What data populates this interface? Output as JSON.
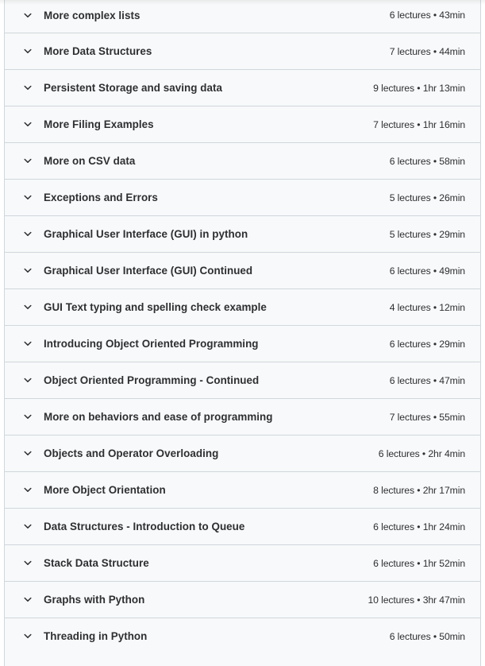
{
  "curriculum": {
    "sections": [
      {
        "title": "More complex lists",
        "meta": "6 lectures • 43min",
        "lectures": 6,
        "duration": "43min",
        "icon": "chevron-down-icon"
      },
      {
        "title": "More Data Structures",
        "meta": "7 lectures • 44min",
        "lectures": 7,
        "duration": "44min",
        "icon": "chevron-down-icon"
      },
      {
        "title": "Persistent Storage and saving data",
        "meta": "9 lectures • 1hr 13min",
        "lectures": 9,
        "duration": "1hr 13min",
        "icon": "chevron-down-icon"
      },
      {
        "title": "More Filing Examples",
        "meta": "7 lectures • 1hr 16min",
        "lectures": 7,
        "duration": "1hr 16min",
        "icon": "chevron-down-icon"
      },
      {
        "title": "More on CSV data",
        "meta": "6 lectures • 58min",
        "lectures": 6,
        "duration": "58min",
        "icon": "chevron-down-icon"
      },
      {
        "title": "Exceptions and Errors",
        "meta": "5 lectures • 26min",
        "lectures": 5,
        "duration": "26min",
        "icon": "chevron-down-icon"
      },
      {
        "title": "Graphical User Interface (GUI) in python",
        "meta": "5 lectures • 29min",
        "lectures": 5,
        "duration": "29min",
        "icon": "chevron-down-icon"
      },
      {
        "title": "Graphical User Interface (GUI) Continued",
        "meta": "6 lectures • 49min",
        "lectures": 6,
        "duration": "49min",
        "icon": "chevron-down-icon"
      },
      {
        "title": "GUI Text typing and spelling check example",
        "meta": "4 lectures • 12min",
        "lectures": 4,
        "duration": "12min",
        "icon": "chevron-down-icon"
      },
      {
        "title": "Introducing Object Oriented Programming",
        "meta": "6 lectures • 29min",
        "lectures": 6,
        "duration": "29min",
        "icon": "chevron-down-icon"
      },
      {
        "title": "Object Oriented Programming - Continued",
        "meta": "6 lectures • 47min",
        "lectures": 6,
        "duration": "47min",
        "icon": "chevron-down-icon"
      },
      {
        "title": "More on behaviors and ease of programming",
        "meta": "7 lectures • 55min",
        "lectures": 7,
        "duration": "55min",
        "icon": "chevron-down-icon"
      },
      {
        "title": "Objects and Operator Overloading",
        "meta": "6 lectures • 2hr 4min",
        "lectures": 6,
        "duration": "2hr 4min",
        "icon": "chevron-down-icon"
      },
      {
        "title": "More Object Orientation",
        "meta": "8 lectures • 2hr 17min",
        "lectures": 8,
        "duration": "2hr 17min",
        "icon": "chevron-down-icon"
      },
      {
        "title": "Data Structures - Introduction to Queue",
        "meta": "6 lectures • 1hr 24min",
        "lectures": 6,
        "duration": "1hr 24min",
        "icon": "chevron-down-icon"
      },
      {
        "title": "Stack Data Structure",
        "meta": "6 lectures • 1hr 52min",
        "lectures": 6,
        "duration": "1hr 52min",
        "icon": "chevron-down-icon"
      },
      {
        "title": "Graphs with Python",
        "meta": "10 lectures • 3hr 47min",
        "lectures": 10,
        "duration": "3hr 47min",
        "icon": "chevron-down-icon"
      },
      {
        "title": "Threading in Python",
        "meta": "6 lectures • 50min",
        "lectures": 6,
        "duration": "50min",
        "icon": "chevron-down-icon"
      }
    ]
  },
  "colors": {
    "row_background": "#f7f9fa",
    "border": "#d1d7dc",
    "text": "#2d2f31"
  }
}
